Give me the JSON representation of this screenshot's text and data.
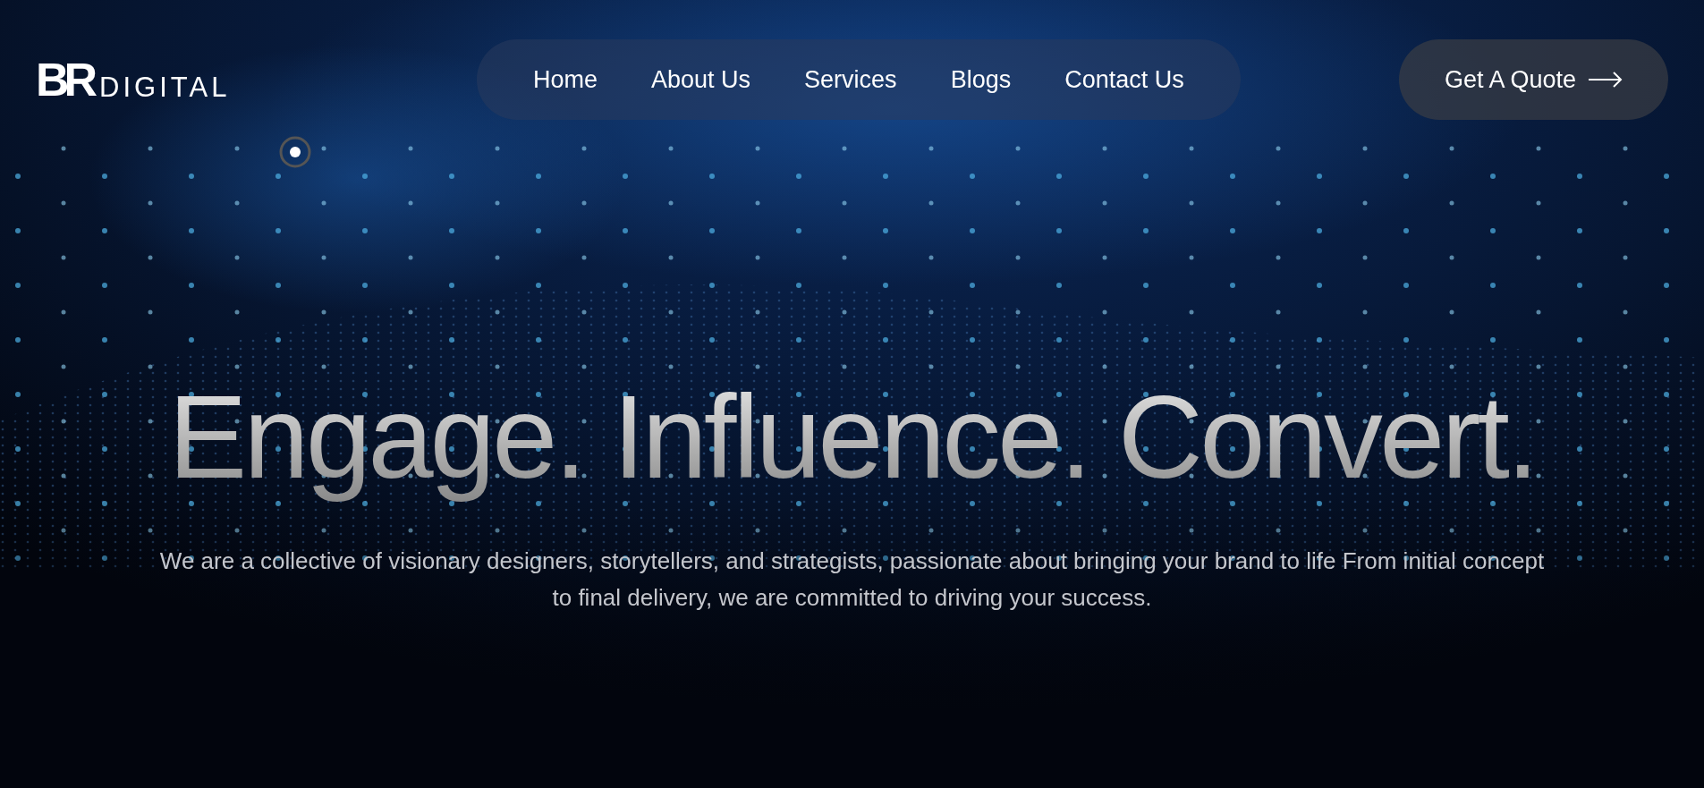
{
  "logo": {
    "mark": "BR",
    "word": "DIGITAL"
  },
  "nav": {
    "items": [
      {
        "label": "Home"
      },
      {
        "label": "About Us"
      },
      {
        "label": "Services"
      },
      {
        "label": "Blogs"
      },
      {
        "label": "Contact Us"
      }
    ]
  },
  "cta": {
    "label": "Get A Quote"
  },
  "hero": {
    "headline": "Engage. Influence. Convert.",
    "text": "We are a collective of visionary designers, storytellers, and strategists, passionate about bringing your brand to life From initial concept to final delivery, we are committed to driving your success."
  }
}
